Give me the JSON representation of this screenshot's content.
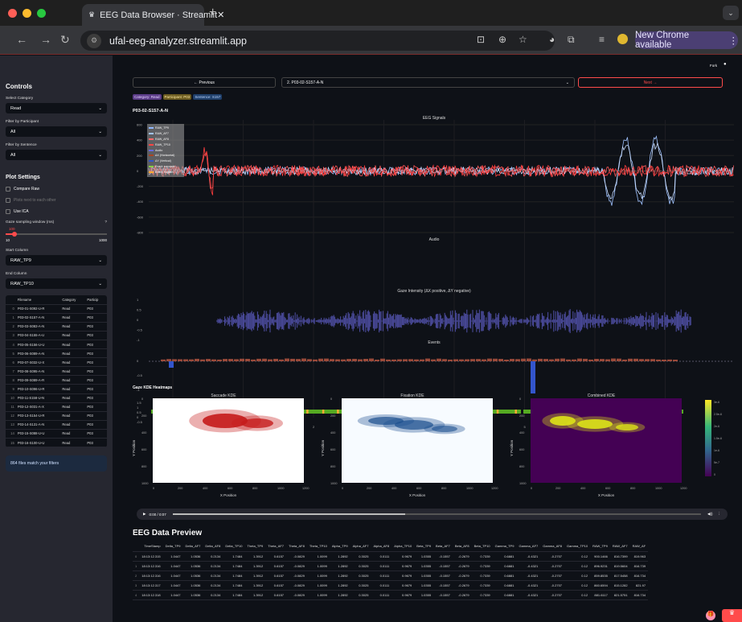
{
  "browser": {
    "tab_title": "EEG Data Browser · Streamlit",
    "url": "ufal-eeg-analyzer.streamlit.app",
    "update_label": "New Chrome available"
  },
  "header": {
    "fork": "Fork"
  },
  "sidebar": {
    "title": "Controls",
    "category_label": "Select Category",
    "category_value": "Read",
    "participant_label": "Filter by Participant",
    "participant_value": "All",
    "sentence_label": "Filter by Sentence",
    "sentence_value": "All",
    "plot_settings": "Plot Settings",
    "compare_raw": "Compare Raw",
    "plots_next": "Plots next to each other",
    "use_ica": "Use ICA",
    "gaze_window_label": "Gaze sampling window (ms)",
    "slider_value": "100",
    "slider_min": "10",
    "slider_max": "1000",
    "start_col_label": "Start Column",
    "start_col_value": "RAW_TP9",
    "end_col_label": "End Column",
    "end_col_value": "RAW_TP10",
    "match_text": "864 files match your filters"
  },
  "files": {
    "headers": [
      "",
      "Filename",
      "Category",
      "Particip"
    ],
    "rows": [
      [
        "0",
        "P03-01-S092-U-R",
        "Read",
        "P03"
      ],
      [
        "1",
        "P03-02-S157-A-N",
        "Read",
        "P03"
      ],
      [
        "2",
        "P03-03-S083-A-N",
        "Read",
        "P03"
      ],
      [
        "3",
        "P03-04-S155-A-U",
        "Read",
        "P03"
      ],
      [
        "4",
        "P03-05-S156-U-U",
        "Read",
        "P03"
      ],
      [
        "5",
        "P03-06-S089-A-N",
        "Read",
        "P03"
      ],
      [
        "6",
        "P03-07-S032-U-X",
        "Read",
        "P03"
      ],
      [
        "7",
        "P03-08-S095-A-N",
        "Read",
        "P03"
      ],
      [
        "8",
        "P03-09-S089-A-R",
        "Read",
        "P03"
      ],
      [
        "9",
        "P03-10-S096-U-R",
        "Read",
        "P03"
      ],
      [
        "10",
        "P03-11-S158-U-N",
        "Read",
        "P03"
      ],
      [
        "11",
        "P03-12-S031-A-X",
        "Read",
        "P03"
      ],
      [
        "12",
        "P03-13-S154-U-R",
        "Read",
        "P03"
      ],
      [
        "13",
        "P03-14-S131-A-N",
        "Read",
        "P03"
      ],
      [
        "14",
        "P03-15-S088-U-U",
        "Read",
        "P03"
      ],
      [
        "15",
        "P03-16-S100-U-U",
        "Read",
        "P03"
      ]
    ]
  },
  "main": {
    "prev": "← Previous",
    "next": "Next →",
    "selected_file": "2. P03-02-S157-A-N",
    "badge_cat": "Category: Read",
    "badge_part": "Participant: P03",
    "badge_sent": "Sentence: S157",
    "file_title": "P03-02-S157-A-N",
    "eeg_title": "EEG Signals",
    "audio_title": "Audio",
    "gaze_title": "Gaze Intensity (ΔX positive, ΔY negative)",
    "events_title": "Events",
    "kde_header": "Gaze KDE Heatmaps",
    "kde1": "Saccade KDE",
    "kde2": "Fixation KDE",
    "kde3": "Combined KDE",
    "xpos": "X Position",
    "ypos": "Y Position",
    "audio_time": "0:00 / 0:07",
    "preview_title": "EEG Data Preview"
  },
  "legend": [
    "RAW_TP9",
    "RAW_AF7",
    "RAW_AF8",
    "RAW_TP10",
    "Audio",
    "ΔX (Horizontal)",
    "ΔY (Vertical)",
    "Event: saccade",
    "Event: fixation"
  ],
  "eeg_yticks": [
    "600",
    "400",
    "200",
    "0",
    "-200",
    "-400",
    "-600",
    "-800"
  ],
  "time_ticks": [
    "0",
    "1",
    "2",
    "3",
    "4",
    "5",
    "6",
    "7"
  ],
  "kde_xticks": [
    "0",
    "200",
    "400",
    "600",
    "800",
    "1000",
    "1200"
  ],
  "kde_yticks": [
    "0",
    "200",
    "400",
    "600",
    "800",
    "1000"
  ],
  "colorbar_ticks": [
    "3e-6",
    "2.5e-6",
    "2e-6",
    "1.5e-6",
    "1e-6",
    "5e-7",
    "0"
  ],
  "preview": {
    "headers": [
      "",
      "TimeStamp",
      "Delta_TP9",
      "Delta_AF7",
      "Delta_AF8",
      "Delta_TP10",
      "Theta_TP9",
      "Theta_AF7",
      "Theta_AF8",
      "Theta_TP10",
      "Alpha_TP9",
      "Alpha_AF7",
      "Alpha_AF8",
      "Alpha_TP10",
      "Beta_TP9",
      "Beta_AF7",
      "Beta_AF8",
      "Beta_TP10",
      "Gamma_TP9",
      "Gamma_AF7",
      "Gamma_AF8",
      "Gamma_TP10",
      "RAW_TP9",
      "RAW_AF7",
      "RAW_AF"
    ],
    "rows": [
      [
        "0",
        "18:13:12.315",
        "1.0447",
        "1.0536",
        "0.2134",
        "1.7484",
        "1.3912",
        "0.6157",
        "-0.0829",
        "1.0099",
        "1.2892",
        "0.3025",
        "0.0111",
        "0.9679",
        "1.0355",
        "-0.1557",
        "-0.2679",
        "0.7339",
        "0.6881",
        "-0.4321",
        "-0.2707",
        "0.12",
        "900.1466",
        "816.7399",
        "819.963"
      ],
      [
        "1",
        "18:13:12.316",
        "1.0447",
        "1.0536",
        "0.2134",
        "1.7484",
        "1.3912",
        "0.6157",
        "-0.0829",
        "1.0099",
        "1.2892",
        "0.3025",
        "0.0111",
        "0.9679",
        "1.0355",
        "-0.1557",
        "-0.2679",
        "0.7339",
        "0.6881",
        "-0.4321",
        "-0.2707",
        "0.12",
        "896.9231",
        "819.5604",
        "816.739"
      ],
      [
        "2",
        "18:13:12.316",
        "1.0447",
        "1.0536",
        "0.2134",
        "1.7484",
        "1.3912",
        "0.6157",
        "-0.0829",
        "1.0099",
        "1.2892",
        "0.3025",
        "0.0111",
        "0.9679",
        "1.0355",
        "-0.1557",
        "-0.2679",
        "0.7339",
        "0.6881",
        "-0.4321",
        "-0.2707",
        "0.12",
        "859.8535",
        "817.5458",
        "816.734"
      ],
      [
        "3",
        "18:13:12.317",
        "1.0447",
        "1.0536",
        "0.2134",
        "1.7484",
        "1.3912",
        "0.6157",
        "-0.0829",
        "1.0099",
        "1.2892",
        "0.3025",
        "0.0111",
        "0.9679",
        "1.0355",
        "-0.1557",
        "-0.2679",
        "0.7339",
        "0.6881",
        "-0.4321",
        "-0.2707",
        "0.12",
        "860.6594",
        "815.1282",
        "821.97"
      ],
      [
        "4",
        "18:13:12.318",
        "1.0447",
        "1.0536",
        "0.2134",
        "1.7484",
        "1.3912",
        "0.6157",
        "-0.0829",
        "1.0099",
        "1.2892",
        "0.3025",
        "0.0111",
        "0.9679",
        "1.0355",
        "-0.1557",
        "-0.2679",
        "0.7339",
        "0.6881",
        "-0.4321",
        "-0.2707",
        "0.12",
        "881.6117",
        "821.5751",
        "816.734"
      ]
    ]
  }
}
